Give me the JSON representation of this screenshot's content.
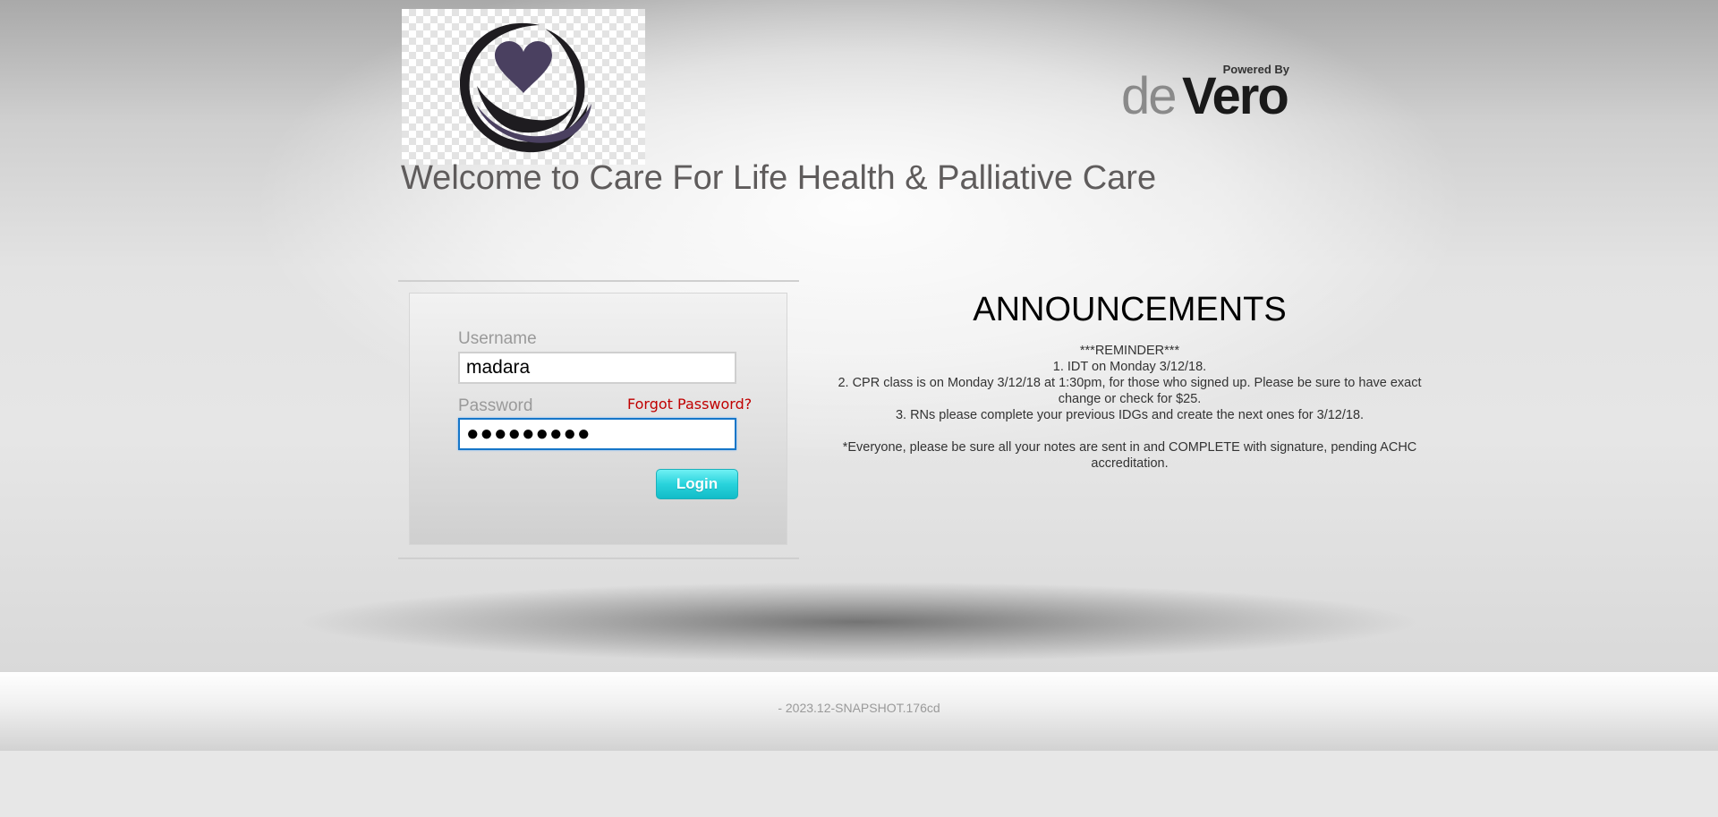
{
  "header": {
    "welcome_text": "Welcome to Care For Life Health & Palliative Care",
    "powered_by": "Powered By",
    "brand_de": "de",
    "brand_vero": "Vero"
  },
  "login": {
    "username_label": "Username",
    "username_value": "madara",
    "password_label": "Password",
    "password_masked": "●●●●●●●●●",
    "forgot_password": "Forgot Password?",
    "login_button": "Login"
  },
  "announcements": {
    "title": "ANNOUNCEMENTS",
    "lines": [
      "***REMINDER***",
      "1. IDT on Monday 3/12/18.",
      "2. CPR class is on Monday 3/12/18 at 1:30pm, for those who signed up. Please be sure to have exact change or check for $25.",
      "3. RNs please complete your previous IDGs and create the next ones for 3/12/18."
    ],
    "note": "*Everyone, please be sure all your notes are sent in and COMPLETE with signature, pending ACHC accreditation."
  },
  "footer": {
    "version": "- 2023.12-SNAPSHOT.176cd"
  },
  "colors": {
    "accent_button": "#29d3dc",
    "forgot_link": "#c00000",
    "focus_border": "#1676c8",
    "logo_dark": "#1e1c20",
    "logo_purple": "#4a4060"
  },
  "icons": {
    "logo": "heart-hands-logo-icon"
  }
}
